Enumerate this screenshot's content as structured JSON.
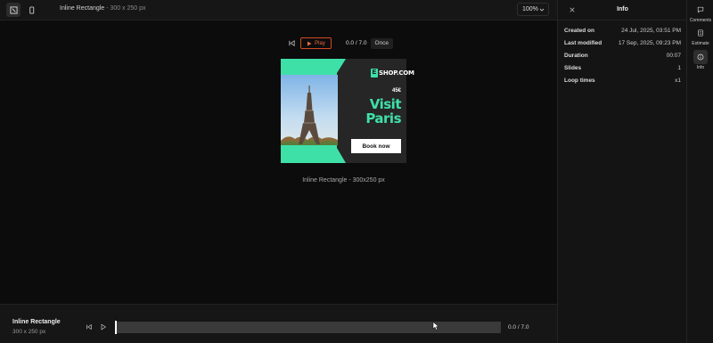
{
  "toolbar": {
    "desktop_view_icon": "responsive-view-icon",
    "mobile_view_icon": "mobile-view-icon",
    "title": "Inline Rectangle",
    "title_size": " - 300 x 250 px",
    "zoom": "100%"
  },
  "preview": {
    "play_label": "Play",
    "time": "0.0 / 7.0",
    "loop_mode": "Once",
    "caption": "Inline Rectangle - 300x250 px"
  },
  "ad": {
    "brand_mark": "E",
    "brand": "SHOP.COM",
    "price": "45€",
    "headline_1": "Visit",
    "headline_2": "Paris",
    "cta": "Book now",
    "accent": "#3fe0a8"
  },
  "timeline": {
    "name": "Inline Rectangle",
    "size": "300 x 250 px",
    "time": "0.0 / 7.0",
    "progress": 0
  },
  "info_panel": {
    "title": "Info",
    "rows": [
      {
        "key": "Created on",
        "value": "24 Jul, 2025, 03:51 PM"
      },
      {
        "key": "Last modified",
        "value": "17 Sep, 2025, 09:23 PM"
      },
      {
        "key": "Duration",
        "value": "00:07"
      },
      {
        "key": "Slides",
        "value": "1"
      },
      {
        "key": "Loop times",
        "value": "x1"
      }
    ]
  },
  "rail": {
    "comments": "Comments",
    "estimate": "Estimate",
    "info": "Info"
  },
  "colors": {
    "accent_play": "#e9693f",
    "background": "#0c0c0c",
    "panel": "#141414"
  }
}
